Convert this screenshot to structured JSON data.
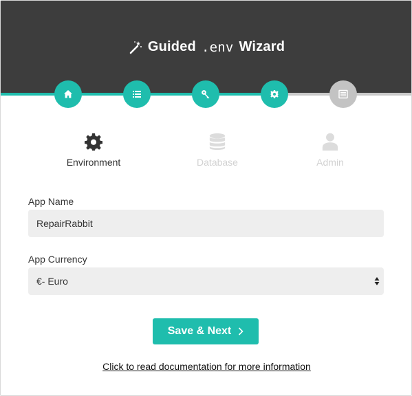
{
  "header": {
    "title_prefix": "Guided",
    "title_code": ".env",
    "title_suffix": "Wizard",
    "icon": "magic-wand-icon"
  },
  "steps": [
    {
      "icon": "home-icon",
      "state": "done"
    },
    {
      "icon": "list-icon",
      "state": "done"
    },
    {
      "icon": "key-icon",
      "state": "done"
    },
    {
      "icon": "gear-icon",
      "state": "done"
    },
    {
      "icon": "server-icon",
      "state": "pending"
    }
  ],
  "tabs": [
    {
      "label": "Environment",
      "icon": "gear-icon",
      "state": "active"
    },
    {
      "label": "Database",
      "icon": "database-icon",
      "state": "disabled"
    },
    {
      "label": "Admin",
      "icon": "user-icon",
      "state": "disabled"
    }
  ],
  "form": {
    "app_name_label": "App Name",
    "app_name_value": "RepairRabbit",
    "app_currency_label": "App Currency",
    "app_currency_value": "€- Euro"
  },
  "actions": {
    "save_label": "Save & Next",
    "doc_link": "Click to read documentation for more information"
  },
  "colors": {
    "accent": "#1fbdad",
    "header_bg": "#3d3d3d",
    "inactive": "#c3c3c3",
    "field_bg": "#eeeeee"
  }
}
